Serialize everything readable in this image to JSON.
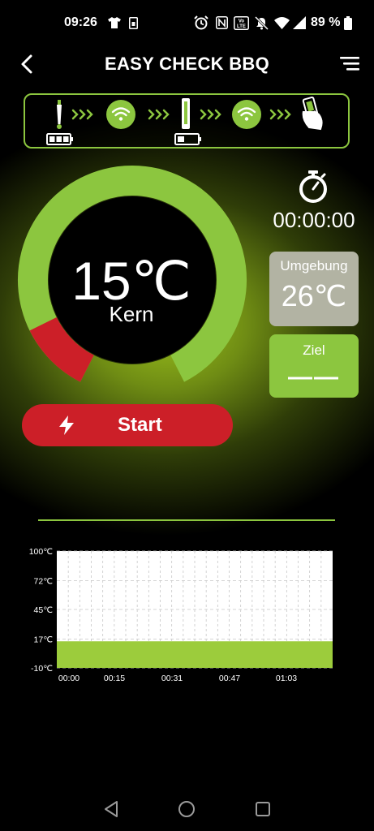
{
  "status_bar": {
    "time": "09:26",
    "battery_percent": "89 %",
    "icons": [
      "tshirt-icon",
      "sim-icon",
      "alarm-icon",
      "nfc-icon",
      "volte-icon",
      "mute-icon",
      "wifi-icon",
      "signal-icon",
      "battery-icon"
    ]
  },
  "header": {
    "title": "EASY CHECK BBQ",
    "back_icon": "chevron-left-icon",
    "menu_icon": "hamburger-menu-icon"
  },
  "connection": {
    "nodes": [
      "probe-icon",
      "wifi-icon",
      "base-station-icon",
      "wifi-icon",
      "phone-icon"
    ],
    "probe_battery_level": 1.0,
    "base_battery_level": 0.35
  },
  "gauge": {
    "core_temp": "15℃",
    "core_label": "Kern",
    "red_fraction": 0.12
  },
  "timer": {
    "icon": "stopwatch-icon",
    "value": "00:00:00"
  },
  "ambient": {
    "label": "Umgebung",
    "value": "26℃"
  },
  "target": {
    "label": "Ziel",
    "value": "——"
  },
  "start_button": {
    "label": "Start",
    "icon": "lightning-icon"
  },
  "colors": {
    "green": "#8cc63f",
    "red": "#cc1f28",
    "gray_card": "#b2b3a3"
  },
  "chart_data": {
    "type": "area",
    "title": "",
    "xlabel": "",
    "ylabel": "",
    "y_ticks": [
      "100℃",
      "72℃",
      "45℃",
      "17℃",
      "-10℃"
    ],
    "y_tick_values": [
      100,
      72,
      45,
      17,
      -10
    ],
    "x_ticks": [
      "00:00",
      "00:15",
      "00:31",
      "00:47",
      "01:03"
    ],
    "ylim": [
      -10,
      100
    ],
    "grid": true,
    "series": [
      {
        "values": [
          15,
          15,
          15,
          15,
          15,
          15,
          15,
          15,
          15,
          15,
          15
        ]
      }
    ]
  }
}
